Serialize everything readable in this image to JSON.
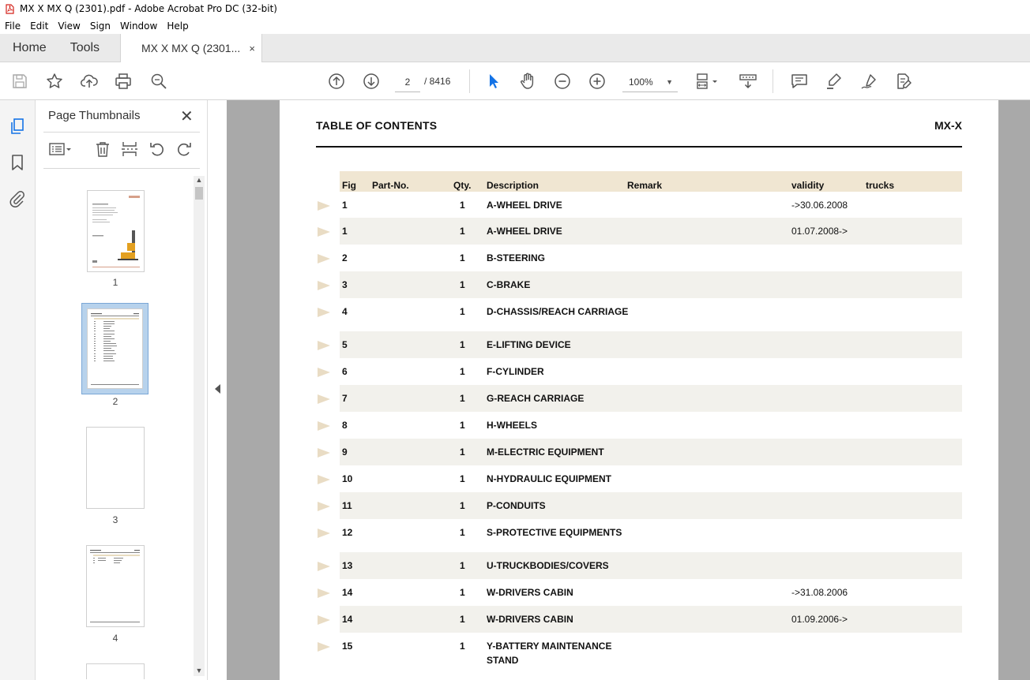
{
  "window": {
    "title": "MX X  MX Q (2301).pdf - Adobe Acrobat Pro DC (32-bit)"
  },
  "menu": [
    "File",
    "Edit",
    "View",
    "Sign",
    "Window",
    "Help"
  ],
  "tabs": {
    "home": "Home",
    "tools": "Tools",
    "document": "MX X  MX Q (2301...",
    "close": "×"
  },
  "toolbar": {
    "current_page": "2",
    "total_pages": "/ 8416",
    "zoom": "100%",
    "icons": [
      "save-icon",
      "star-icon",
      "upload-icon",
      "print-icon",
      "search-zoom-icon",
      "page-up-icon",
      "page-down-icon",
      "select-cursor-icon",
      "hand-icon",
      "zoom-out-icon",
      "zoom-in-icon",
      "fit-page-icon",
      "scroll-mode-icon",
      "comment-icon",
      "highlight-icon",
      "sign-icon",
      "edit-pdf-icon"
    ]
  },
  "panel": {
    "title": "Page Thumbnails",
    "close": "✕",
    "thumbnails": [
      {
        "label": "1"
      },
      {
        "label": "2"
      },
      {
        "label": "3"
      },
      {
        "label": "4"
      }
    ]
  },
  "document": {
    "header_left": "TABLE OF CONTENTS",
    "header_right": "MX-X",
    "columns": {
      "fig": "Fig",
      "part_no": "Part-No.",
      "qty": "Qty.",
      "description": "Description",
      "remark": "Remark",
      "validity": "validity",
      "trucks": "trucks"
    },
    "rows": [
      {
        "fig": "1",
        "qty": "1",
        "desc": "A-WHEEL DRIVE",
        "validity": "->30.06.2008"
      },
      {
        "fig": "1",
        "qty": "1",
        "desc": "A-WHEEL DRIVE",
        "validity": "01.07.2008->"
      },
      {
        "fig": "2",
        "qty": "1",
        "desc": "B-STEERING",
        "validity": ""
      },
      {
        "fig": "3",
        "qty": "1",
        "desc": "C-BRAKE",
        "validity": ""
      },
      {
        "fig": "4",
        "qty": "1",
        "desc": "D-CHASSIS/REACH CARRIAGE",
        "validity": ""
      },
      {
        "fig": "5",
        "qty": "1",
        "desc": "E-LIFTING DEVICE",
        "validity": ""
      },
      {
        "fig": "6",
        "qty": "1",
        "desc": "F-CYLINDER",
        "validity": ""
      },
      {
        "fig": "7",
        "qty": "1",
        "desc": "G-REACH CARRIAGE",
        "validity": ""
      },
      {
        "fig": "8",
        "qty": "1",
        "desc": "H-WHEELS",
        "validity": ""
      },
      {
        "fig": "9",
        "qty": "1",
        "desc": "M-ELECTRIC EQUIPMENT",
        "validity": ""
      },
      {
        "fig": "10",
        "qty": "1",
        "desc": "N-HYDRAULIC EQUIPMENT",
        "validity": ""
      },
      {
        "fig": "11",
        "qty": "1",
        "desc": "P-CONDUITS",
        "validity": ""
      },
      {
        "fig": "12",
        "qty": "1",
        "desc": "S-PROTECTIVE EQUIPMENTS",
        "validity": ""
      },
      {
        "fig": "13",
        "qty": "1",
        "desc": "U-TRUCKBODIES/COVERS",
        "validity": ""
      },
      {
        "fig": "14",
        "qty": "1",
        "desc": "W-DRIVERS CABIN",
        "validity": "->31.08.2006"
      },
      {
        "fig": "14",
        "qty": "1",
        "desc": "W-DRIVERS CABIN",
        "validity": "01.09.2006->"
      },
      {
        "fig": "15",
        "qty": "1",
        "desc": "Y-BATTERY MAINTENANCE STAND",
        "validity": ""
      }
    ]
  },
  "colors": {
    "acrobat_red": "#d4231b",
    "selection_blue": "#1473e6",
    "header_beige": "#f0e6d2",
    "row_shade": "#f2f1ec"
  }
}
